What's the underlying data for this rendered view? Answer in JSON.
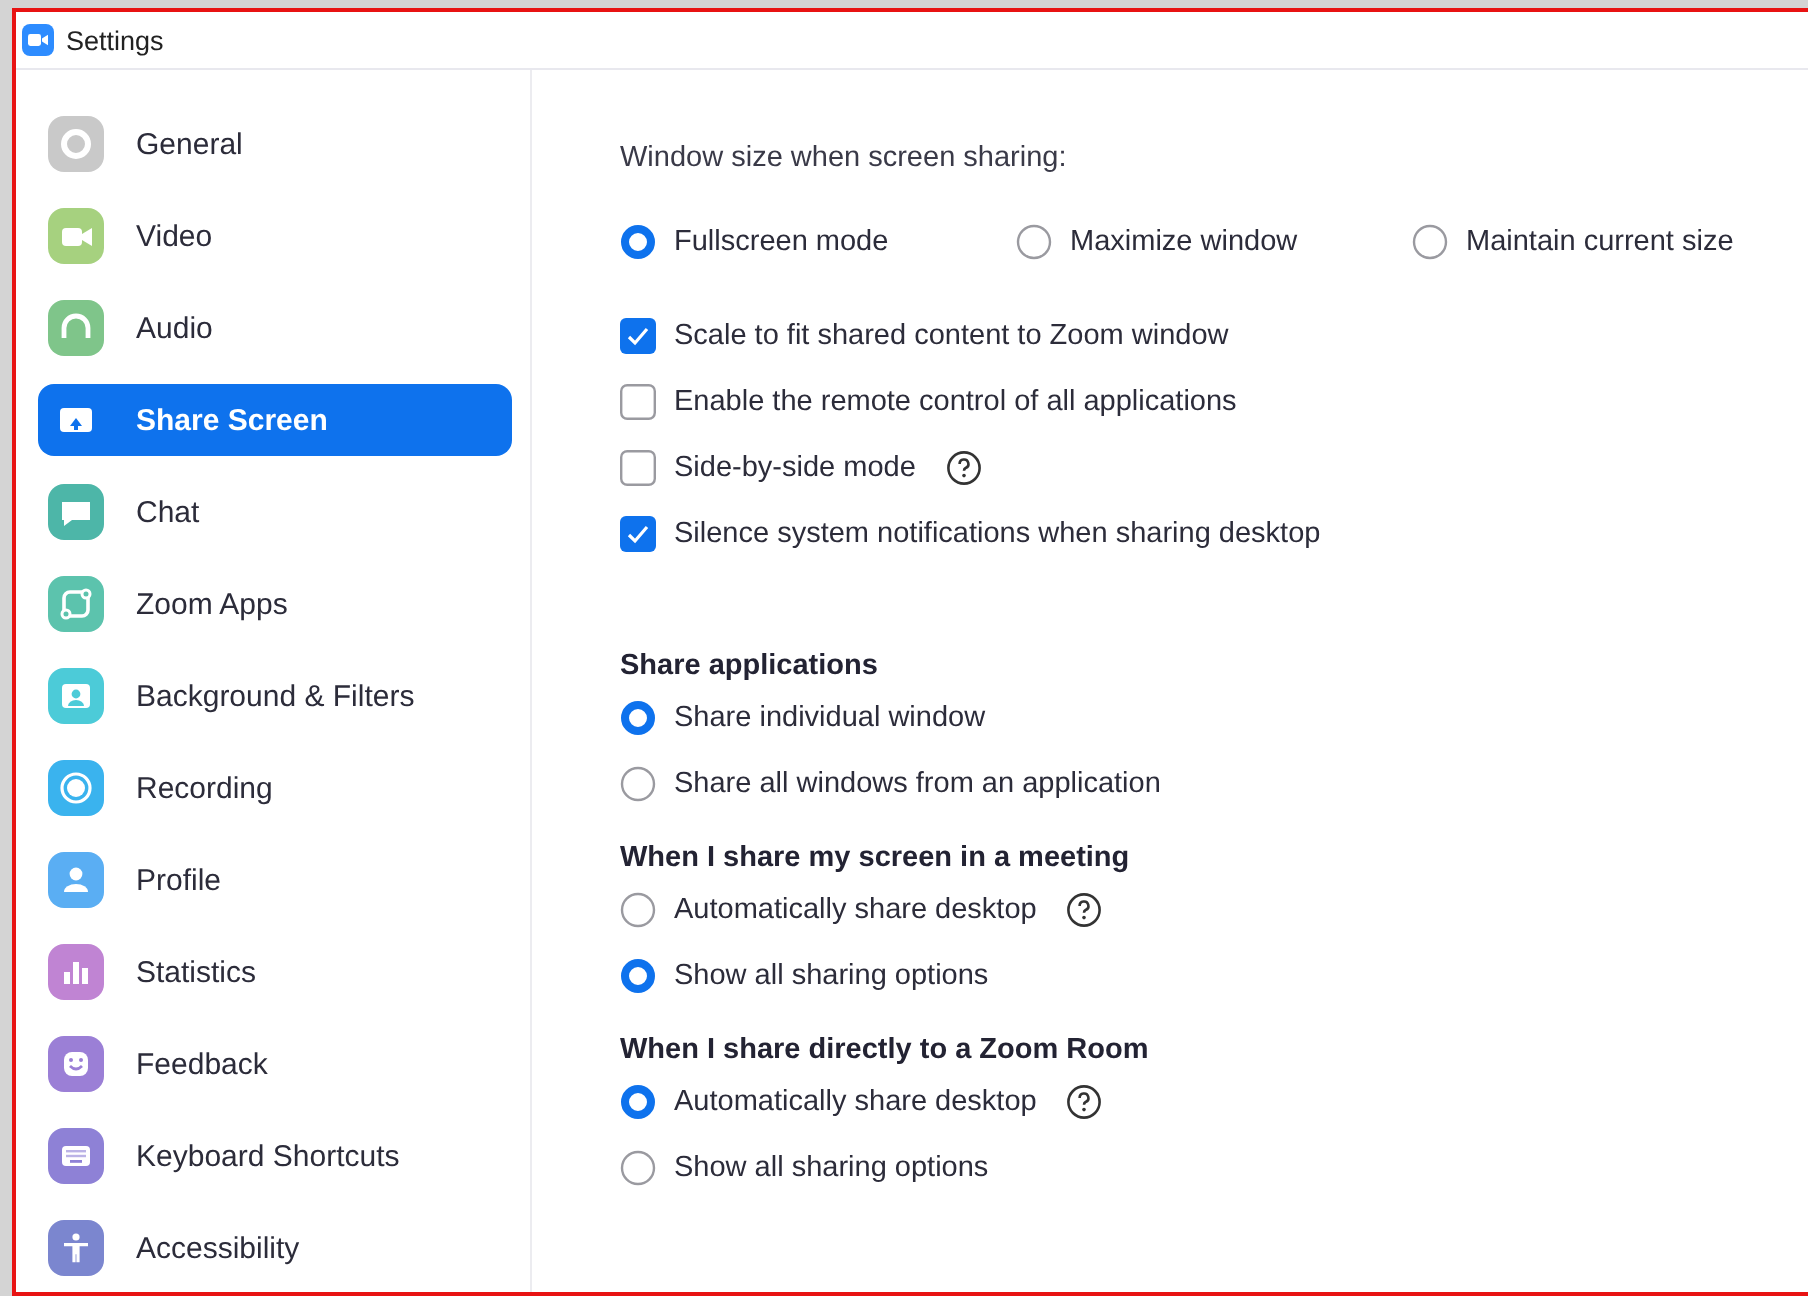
{
  "window": {
    "title": "Settings"
  },
  "sidebar": {
    "items": [
      {
        "label": "General",
        "selected": false
      },
      {
        "label": "Video",
        "selected": false
      },
      {
        "label": "Audio",
        "selected": false
      },
      {
        "label": "Share Screen",
        "selected": true
      },
      {
        "label": "Chat",
        "selected": false
      },
      {
        "label": "Zoom Apps",
        "selected": false
      },
      {
        "label": "Background & Filters",
        "selected": false
      },
      {
        "label": "Recording",
        "selected": false
      },
      {
        "label": "Profile",
        "selected": false
      },
      {
        "label": "Statistics",
        "selected": false
      },
      {
        "label": "Feedback",
        "selected": false
      },
      {
        "label": "Keyboard Shortcuts",
        "selected": false
      },
      {
        "label": "Accessibility",
        "selected": false
      }
    ]
  },
  "content": [
    {
      "kind": "inline-radios",
      "title": "Window size when screen sharing:",
      "options": [
        {
          "label": "Fullscreen mode",
          "selected": true
        },
        {
          "label": "Maximize window",
          "selected": false
        },
        {
          "label": "Maintain current size",
          "selected": false
        }
      ]
    },
    {
      "kind": "checkboxes",
      "items": [
        {
          "label": "Scale to fit shared content to Zoom window",
          "checked": true
        },
        {
          "label": "Enable the remote control of all applications",
          "checked": false
        },
        {
          "label": "Side-by-side mode",
          "checked": false,
          "help": true
        },
        {
          "label": "Silence system notifications when sharing desktop",
          "checked": true
        }
      ]
    },
    {
      "kind": "radio-group",
      "title": "Share applications",
      "options": [
        {
          "label": "Share individual window",
          "selected": true
        },
        {
          "label": "Share all windows from an application",
          "selected": false
        }
      ]
    },
    {
      "kind": "radio-group",
      "title": "When I share my screen in a meeting",
      "options": [
        {
          "label": "Automatically share desktop",
          "selected": false,
          "help": true
        },
        {
          "label": "Show all sharing options",
          "selected": true
        }
      ]
    },
    {
      "kind": "radio-group",
      "title": "When I share directly to a Zoom Room",
      "options": [
        {
          "label": "Automatically share desktop",
          "selected": true,
          "help": true
        },
        {
          "label": "Show all sharing options",
          "selected": false
        }
      ]
    }
  ]
}
